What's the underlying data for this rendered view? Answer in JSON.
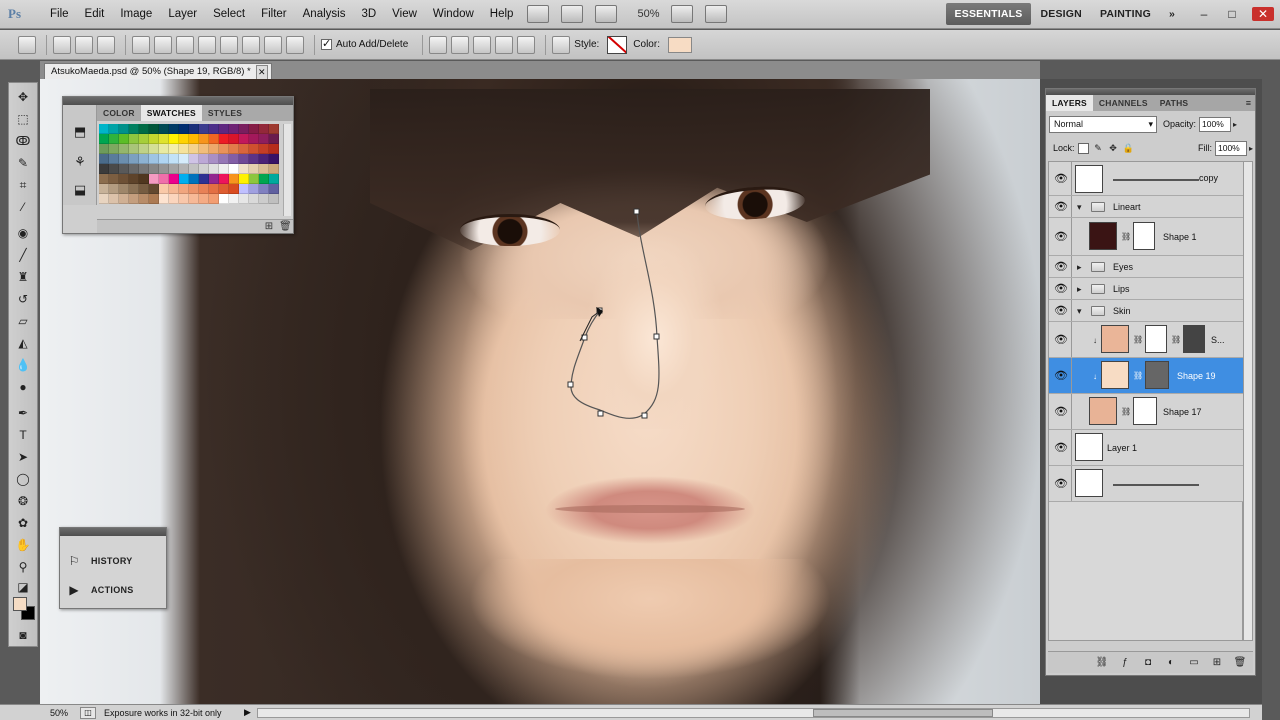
{
  "app": {
    "logo": "Ps"
  },
  "menu": [
    "File",
    "Edit",
    "Image",
    "Layer",
    "Select",
    "Filter",
    "Analysis",
    "3D",
    "View",
    "Window",
    "Help"
  ],
  "appbar": {
    "zoom": "50%"
  },
  "workspaces": [
    "ESSENTIALS",
    "DESIGN",
    "PAINTING"
  ],
  "workspace_more": "»",
  "window_controls": {
    "minimize": "–",
    "restore": "□",
    "close": "✕"
  },
  "options": {
    "auto_add_delete": "Auto Add/Delete",
    "auto_add_delete_checked": true,
    "style_label": "Style:",
    "color_label": "Color:",
    "color_value": "#f7dcc4"
  },
  "document": {
    "tab_title": "AtsukoMaeda.psd @ 50% (Shape 19, RGB/8) *",
    "close": "✕"
  },
  "swatches_panel": {
    "tabs": [
      "COLOR",
      "SWATCHES",
      "STYLES"
    ],
    "active_tab": "SWATCHES",
    "colors": [
      "#00b5c9",
      "#00a3a6",
      "#00918a",
      "#008060",
      "#006b45",
      "#00563a",
      "#004a54",
      "#003b66",
      "#002d70",
      "#1a2f7a",
      "#3b3b8e",
      "#4c2e8a",
      "#5e2780",
      "#6e2274",
      "#7a1e5e",
      "#861c46",
      "#93283a",
      "#9e3a30",
      "#00a650",
      "#2fb33b",
      "#5cbd26",
      "#8dc63f",
      "#a6ce39",
      "#c4d82e",
      "#dfe32d",
      "#fff200",
      "#ffd200",
      "#ffb800",
      "#f7941d",
      "#f26522",
      "#ed1c24",
      "#d9152a",
      "#c2185b",
      "#a3195b",
      "#8e1e5c",
      "#6a1b4d",
      "#6d9b5b",
      "#7fa860",
      "#94b66d",
      "#a9c47a",
      "#bfd288",
      "#d4df96",
      "#e8eba3",
      "#f4eeaa",
      "#f6e39c",
      "#f5d28d",
      "#f2bd7c",
      "#ee a86b",
      "#e9925a",
      "#e27b4a",
      "#d9653c",
      "#cf502f",
      "#c43d25",
      "#b62c1c",
      "#4a6b8a",
      "#5a7c9c",
      "#6b8eae",
      "#7ca0c0",
      "#8db2d2",
      "#9ec4e4",
      "#b0d5f2",
      "#c2e2f8",
      "#d6ecfb",
      "#cfc3e6",
      "#bca8d6",
      "#a98fc6",
      "#9576b6",
      "#825ea6",
      "#6f4896",
      "#5c3386",
      "#4a2176",
      "#381266",
      "#3b3b3b",
      "#4a4a4a",
      "#595959",
      "#686868",
      "#777777",
      "#868686",
      "#959595",
      "#a4a4a4",
      "#b3b3b3",
      "#c2c2c2",
      "#d1d1d1",
      "#e0e0e0",
      "#efefef",
      "#ffffff",
      "#f0e0c8",
      "#e5cfae",
      "#d8bc94",
      "#cba87b",
      "#8b6d4e",
      "#7c5e41",
      "#6d5035",
      "#5e432a",
      "#50371f",
      "#f49ac1",
      "#f06eaa",
      "#ec008c",
      "#00aeef",
      "#0072bc",
      "#2e3192",
      "#92278f",
      "#ed145b",
      "#f7941d",
      "#fff200",
      "#8dc63f",
      "#00a651",
      "#00a99d",
      "#c7b299",
      "#b39c81",
      "#9e866a",
      "#8a7155",
      "#765c41",
      "#62482f",
      "#f9c9a8",
      "#f5b793",
      "#f1a57e",
      "#ec936a",
      "#e88156",
      "#e36f43",
      "#de5d31",
      "#d94b20",
      "#c0c0ff",
      "#a0a0e0",
      "#8080c0",
      "#6060a0",
      "#e8d4c0",
      "#dcc2aa",
      "#d0b094",
      "#c49e7e",
      "#b88c68",
      "#ac7a52",
      "#fde3d0",
      "#fbd5bd",
      "#f9c7aa",
      "#f7b997",
      "#f5ab84",
      "#f39d71",
      "#ffffff",
      "#f2f2f2",
      "#e6e6e6",
      "#d9d9d9",
      "#cccccc",
      "#bfbfbf"
    ]
  },
  "history_panel": {
    "items": [
      "HISTORY",
      "ACTIONS"
    ]
  },
  "layers_panel": {
    "tabs": [
      "LAYERS",
      "CHANNELS",
      "PATHS"
    ],
    "blend_mode": "Normal",
    "opacity_label": "Opacity:",
    "opacity": "100%",
    "lock_label": "Lock:",
    "fill_label": "Fill:",
    "fill": "100%",
    "layers": [
      {
        "name": "copy"
      },
      {
        "name": "Lineart"
      },
      {
        "name": "Shape 1"
      },
      {
        "name": "Eyes"
      },
      {
        "name": "Lips"
      },
      {
        "name": "Skin"
      },
      {
        "name": "S..."
      },
      {
        "name": "Shape 19"
      },
      {
        "name": "Shape 17"
      },
      {
        "name": "Layer 1"
      },
      {
        "name": ""
      }
    ]
  },
  "status": {
    "zoom": "50%",
    "message": "Exposure works in 32-bit only"
  }
}
